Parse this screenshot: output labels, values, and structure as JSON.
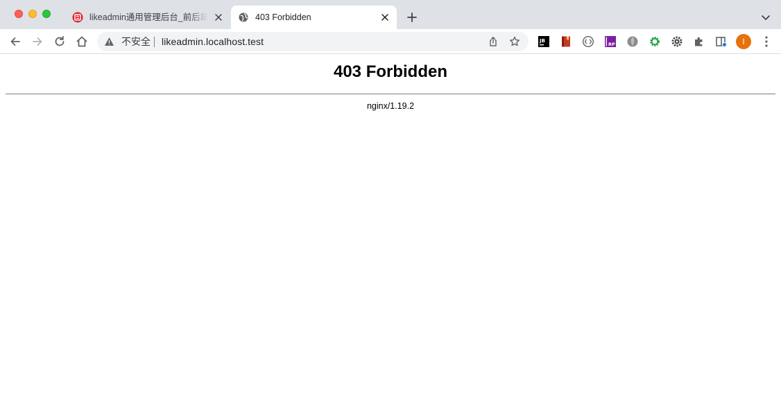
{
  "tabs": [
    {
      "title": "likeadmin通用管理后台_前后端分离",
      "active": false,
      "favicon": "likeadmin-logo-icon"
    },
    {
      "title": "403 Forbidden",
      "active": true,
      "favicon": "globe-icon"
    }
  ],
  "toolbar": {
    "security_label": "不安全",
    "url": "likeadmin.localhost.test",
    "avatar_initial": "I"
  },
  "extensions": [
    "jetbrains-icon",
    "bookmark-red-icon",
    "code-brackets-icon",
    "rp-icon",
    "gray-circle-icon",
    "green-gear-icon",
    "dark-gear-icon",
    "puzzle-icon",
    "reading-list-icon"
  ],
  "page": {
    "heading": "403 Forbidden",
    "server": "nginx/1.19.2"
  },
  "colors": {
    "tabstrip_bg": "#dee1e6",
    "omnibox_bg": "#f1f3f4",
    "avatar_bg": "#e8710a",
    "likeadmin_red": "#e0202b"
  }
}
